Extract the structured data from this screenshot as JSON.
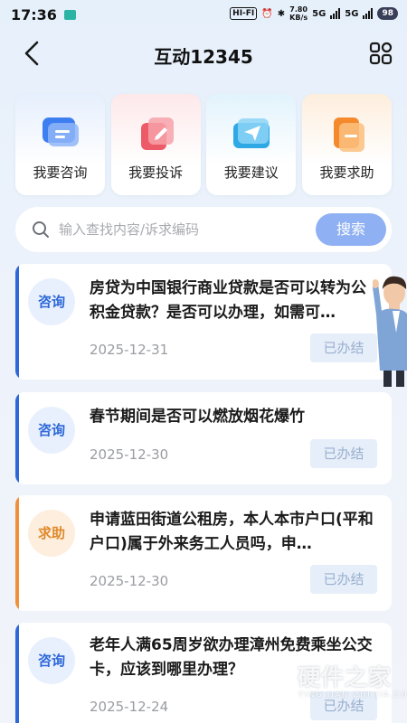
{
  "status_bar": {
    "time": "17:36",
    "hifi": "HI-FI",
    "net_speed_value": "7.80",
    "net_speed_unit": "KB/s",
    "signal_1": "5G",
    "signal_2": "5G",
    "battery": "98"
  },
  "nav": {
    "title": "互动12345"
  },
  "quick_actions": [
    {
      "label": "我要咨询",
      "icon": "chat-icon",
      "color": "#3d7ef0"
    },
    {
      "label": "我要投诉",
      "icon": "complaint-edit-icon",
      "color": "#ee5b68"
    },
    {
      "label": "我要建议",
      "icon": "send-icon",
      "color": "#2fa8e6"
    },
    {
      "label": "我要求助",
      "icon": "help-document-icon",
      "color": "#f48a2c"
    }
  ],
  "search": {
    "placeholder": "输入查找内容/诉求编码",
    "button_label": "搜索"
  },
  "items": [
    {
      "tag": "咨询",
      "title": "房贷为中国银行商业贷款是否可以转为公积金贷款？是否可以办理，如需可…",
      "date": "2025-12-31",
      "status": "已办结",
      "accent": "#2d67d8"
    },
    {
      "tag": "咨询",
      "title": "春节期间是否可以燃放烟花爆竹",
      "date": "2025-12-30",
      "status": "已办结",
      "accent": "#2d67d8"
    },
    {
      "tag": "求助",
      "title": "申请蓝田街道公租房，本人本市户口(平和户口)属于外来务工人员吗，申…",
      "date": "2025-12-30",
      "status": "已办结",
      "accent": "#f0903a"
    },
    {
      "tag": "咨询",
      "title": "老年人满65周岁欲办理漳州免费乘坐公交卡，应该到哪里办理？",
      "date": "2025-12-24",
      "status": "已办结",
      "accent": "#2d67d8"
    }
  ],
  "watermark": {
    "text": "硬件之家",
    "sub": "YING JIAN ZHI JIA.COM"
  }
}
